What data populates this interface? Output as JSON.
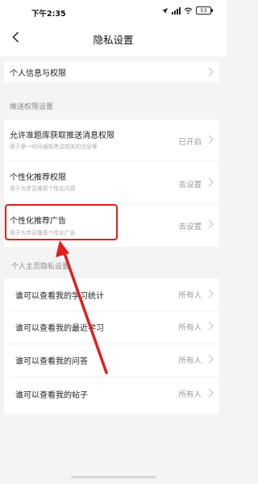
{
  "status_bar": {
    "time": "下午2:35",
    "battery_level": "53",
    "icons": [
      "location-icon",
      "signal-icon",
      "wifi-icon",
      "battery-icon"
    ]
  },
  "header": {
    "title": "隐私设置",
    "back_icon": "chevron-left-icon"
  },
  "sections": {
    "personal_info": {
      "label": "个人信息与权限"
    },
    "push": {
      "section_label": "推送权限设置",
      "items": [
        {
          "title": "允许准题库获取推送消息权限",
          "subtitle": "用于第一时间通知考试相关的信息等",
          "value": "已开启"
        },
        {
          "title": "个性化推荐权限",
          "subtitle": "用于为学员推荐个性化内容",
          "value": "去设置"
        },
        {
          "title": "个性化推荐广告",
          "subtitle": "用于为学员推荐个性化广告",
          "value": "去设置"
        }
      ]
    },
    "homepage": {
      "section_label": "个人主页隐私设置",
      "items": [
        {
          "title": "谁可以查看我的学习统计",
          "value": "所有人"
        },
        {
          "title": "谁可以查看我的最近学习",
          "value": "所有人"
        },
        {
          "title": "谁可以查看我的问答",
          "value": "所有人"
        },
        {
          "title": "谁可以查看我的帖子",
          "value": "所有人"
        }
      ]
    }
  },
  "annotation": {
    "highlight_color": "#e21f1f",
    "highlighted_item": "个性化推荐广告"
  }
}
